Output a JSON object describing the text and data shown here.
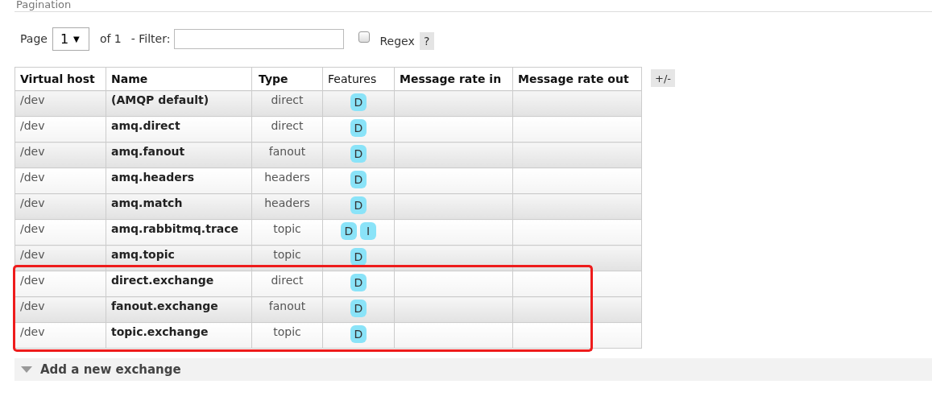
{
  "section": {
    "title": "Pagination"
  },
  "pagination": {
    "page_label": "Page",
    "page_value": "1",
    "page_caret": "▼",
    "of_label": "of 1",
    "filter_label": "- Filter:",
    "regex_label": "Regex",
    "regex_checked": false,
    "help": "?"
  },
  "table": {
    "columns": [
      {
        "label": "Virtual host",
        "bold": true
      },
      {
        "label": "Name",
        "bold": true
      },
      {
        "label": "Type",
        "bold": true
      },
      {
        "label": "Features",
        "bold": false
      },
      {
        "label": "Message rate in",
        "bold": true
      },
      {
        "label": "Message rate out",
        "bold": true
      }
    ],
    "toggle": "+/-",
    "rows": [
      {
        "vhost": "/dev",
        "name": "(AMQP default)",
        "type": "direct",
        "features": [
          "D"
        ],
        "highlighted": false
      },
      {
        "vhost": "/dev",
        "name": "amq.direct",
        "type": "direct",
        "features": [
          "D"
        ],
        "highlighted": false
      },
      {
        "vhost": "/dev",
        "name": "amq.fanout",
        "type": "fanout",
        "features": [
          "D"
        ],
        "highlighted": false
      },
      {
        "vhost": "/dev",
        "name": "amq.headers",
        "type": "headers",
        "features": [
          "D"
        ],
        "highlighted": false
      },
      {
        "vhost": "/dev",
        "name": "amq.match",
        "type": "headers",
        "features": [
          "D"
        ],
        "highlighted": false
      },
      {
        "vhost": "/dev",
        "name": "amq.rabbitmq.trace",
        "type": "topic",
        "features": [
          "D",
          "I"
        ],
        "highlighted": false
      },
      {
        "vhost": "/dev",
        "name": "amq.topic",
        "type": "topic",
        "features": [
          "D"
        ],
        "highlighted": false
      },
      {
        "vhost": "/dev",
        "name": "direct.exchange",
        "type": "direct",
        "features": [
          "D"
        ],
        "highlighted": true
      },
      {
        "vhost": "/dev",
        "name": "fanout.exchange",
        "type": "fanout",
        "features": [
          "D"
        ],
        "highlighted": true
      },
      {
        "vhost": "/dev",
        "name": "topic.exchange",
        "type": "topic",
        "features": [
          "D"
        ],
        "highlighted": true
      }
    ]
  },
  "add_section": {
    "title": "Add a new exchange",
    "expanded": false
  }
}
